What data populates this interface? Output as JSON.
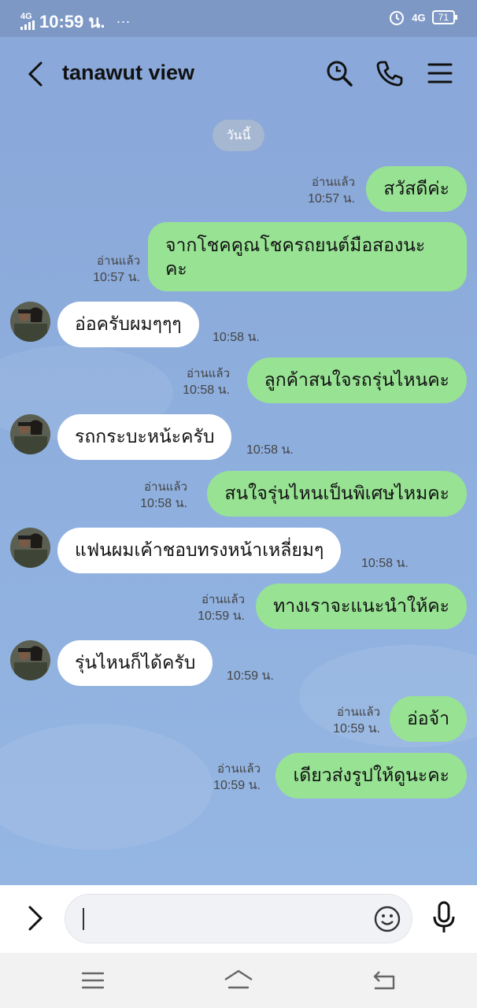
{
  "status_bar": {
    "network": "4G",
    "time": "10:59 น.",
    "dots": "···",
    "network_right": "4G",
    "battery": "71"
  },
  "header": {
    "title": "tanawut view"
  },
  "chat": {
    "date_label": "วันนี้",
    "messages": [
      {
        "side": "out",
        "text": "สวัสดีค่ะ",
        "read": "อ่านแล้ว",
        "time": "10:57 น."
      },
      {
        "side": "out",
        "line1": "จากโชคคูณโชครถยนต์มือสองนะ",
        "line2": "คะ",
        "read": "อ่านแล้ว",
        "time": "10:57 น."
      },
      {
        "side": "in",
        "text": "อ่อครับผมๆๆๆ",
        "time": "10:58 น."
      },
      {
        "side": "out",
        "text": "ลูกค้าสนใจรถรุ่นไหนคะ",
        "read": "อ่านแล้ว",
        "time": "10:58 น."
      },
      {
        "side": "in",
        "text": "รถกระบะหน้ะครับ",
        "time": "10:58 น."
      },
      {
        "side": "out",
        "text": "สนใจรุ่นไหนเป็นพิเศษไหมคะ",
        "read": "อ่านแล้ว",
        "time": "10:58 น."
      },
      {
        "side": "in",
        "text": "แฟนผมเค้าชอบทรงหน้าเหลี่ยมๆ",
        "time": "10:58 น."
      },
      {
        "side": "out",
        "text": "ทางเราจะแนะนำให้คะ",
        "read": "อ่านแล้ว",
        "time": "10:59 น."
      },
      {
        "side": "in",
        "text": "รุ่นไหนก็ได้ครับ",
        "time": "10:59 น."
      },
      {
        "side": "out",
        "text": "อ่อจ้า",
        "read": "อ่านแล้ว",
        "time": "10:59 น."
      },
      {
        "side": "out",
        "text": "เดียวส่งรูปให้ดูนะคะ",
        "read": "อ่านแล้ว",
        "time": "10:59 น."
      }
    ]
  },
  "composer": {
    "value": "",
    "placeholder": ""
  },
  "icons": {
    "back": "chevron-left-icon",
    "search": "search-icon",
    "call": "phone-icon",
    "menu": "hamburger-icon",
    "expand": "chevron-right-icon",
    "emoji": "smiley-icon",
    "mic": "microphone-icon",
    "nav_recent": "recent-apps-icon",
    "nav_home": "home-icon",
    "nav_back": "back-icon"
  },
  "colors": {
    "outgoing_bubble": "#98e294",
    "incoming_bubble": "#ffffff",
    "chat_background": "#8ba8d8"
  }
}
